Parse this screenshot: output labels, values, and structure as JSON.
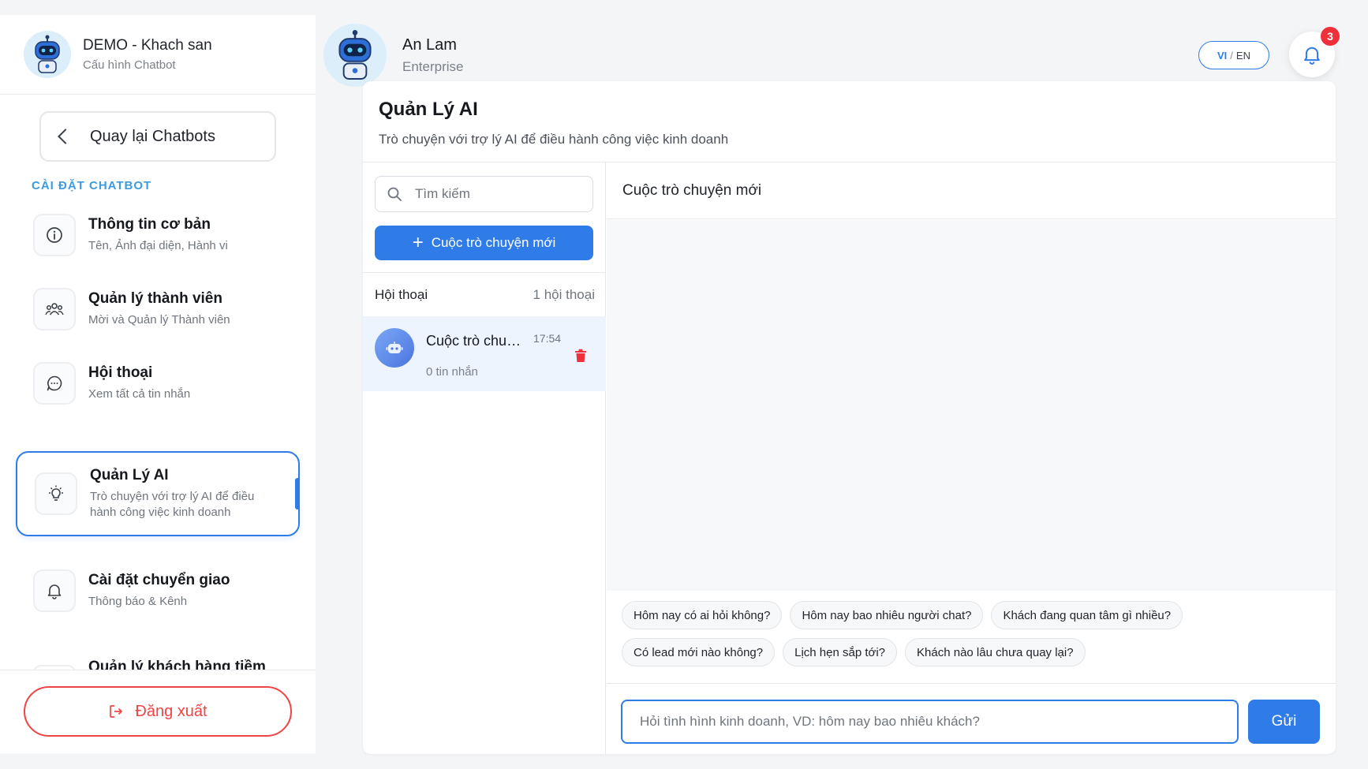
{
  "sidebar": {
    "bot_name": "DEMO - Khach san",
    "bot_subtitle": "Cấu hình Chatbot",
    "back_label": "Quay lại Chatbots",
    "section_label": "CÀI ĐẶT CHATBOT",
    "items": [
      {
        "title": "Thông tin cơ bản",
        "desc": "Tên, Ảnh đại diện, Hành vi",
        "icon": "info-icon"
      },
      {
        "title": "Quản lý thành viên",
        "desc": "Mời và Quản lý Thành viên",
        "icon": "users-icon"
      },
      {
        "title": "Hội thoại",
        "desc": "Xem tất cả tin nhắn",
        "icon": "chat-bubble-icon"
      },
      {
        "title": "Quản Lý AI",
        "desc": "Trò chuyện với trợ lý AI để điều hành công việc kinh doanh",
        "icon": "lightbulb-icon",
        "active": true
      },
      {
        "title": "Cài đặt chuyển giao",
        "desc": "Thông báo & Kênh",
        "icon": "bell-icon"
      },
      {
        "title": "Quản lý khách hàng tiềm",
        "desc": "",
        "icon": ""
      }
    ],
    "logout_label": "Đăng xuất"
  },
  "header": {
    "user_name": "An Lam",
    "user_plan": "Enterprise",
    "lang_vi": "VI",
    "lang_sep": "/",
    "lang_en": "EN",
    "notification_count": "3"
  },
  "main": {
    "title": "Quản Lý AI",
    "subtitle": "Trò chuyện với trợ lý AI để điều hành công việc kinh doanh",
    "search_placeholder": "Tìm kiếm",
    "new_conv_label": "Cuộc trò chuyện mới",
    "list_title": "Hội thoại",
    "list_count": "1 hội thoại",
    "conversations": [
      {
        "name": "Cuộc trò chuyện mới",
        "time": "17:54",
        "messages": "0 tin nhắn"
      }
    ],
    "chat_title": "Cuộc trò chuyện mới",
    "suggestions_row1": [
      "Hôm nay có ai hỏi không?",
      "Hôm nay bao nhiêu người chat?",
      "Khách đang quan tâm gì nhiều?"
    ],
    "suggestions_row2": [
      "Có lead mới nào không?",
      "Lịch hẹn sắp tới?",
      "Khách nào lâu chưa quay lại?"
    ],
    "input_placeholder": "Hỏi tình hình kinh doanh, VD: hôm nay bao nhiêu khách?",
    "send_label": "Gửi"
  },
  "colors": {
    "accent": "#2f7be8",
    "danger": "#ef4444",
    "section_label": "#3d9be0"
  }
}
